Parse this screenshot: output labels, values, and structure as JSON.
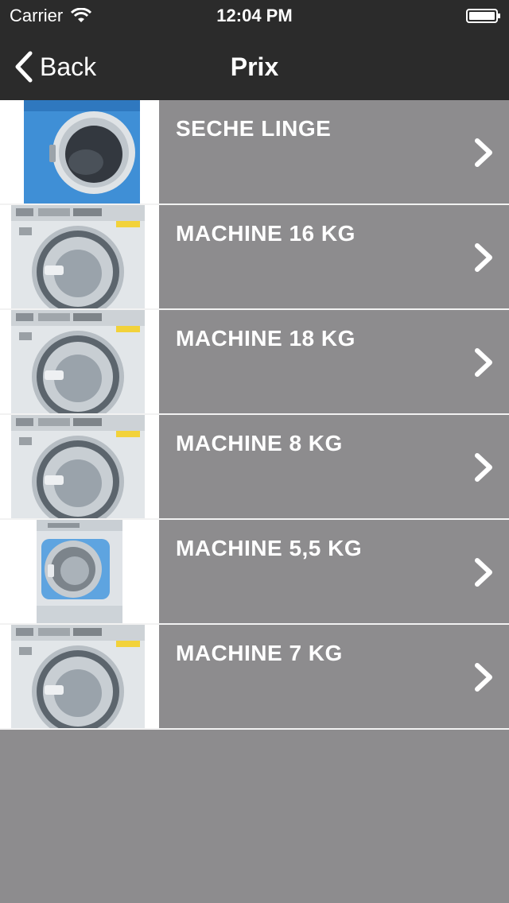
{
  "status_bar": {
    "carrier": "Carrier",
    "time": "12:04 PM"
  },
  "nav": {
    "back_label": "Back",
    "title": "Prix"
  },
  "items": [
    {
      "label": "SECHE LINGE",
      "image": "dryer-image"
    },
    {
      "label": "MACHINE 16 KG",
      "image": "washer-image"
    },
    {
      "label": "MACHINE 18 KG",
      "image": "washer-image"
    },
    {
      "label": "MACHINE 8 KG",
      "image": "washer-image"
    },
    {
      "label": "MACHINE 5,5 KG",
      "image": "blue-washer-image"
    },
    {
      "label": "MACHINE 7 KG",
      "image": "washer-image"
    }
  ],
  "colors": {
    "bar": "#2b2b2b",
    "row_background": "#8d8c8e",
    "separator": "#f2f2f2",
    "text": "#ffffff"
  }
}
